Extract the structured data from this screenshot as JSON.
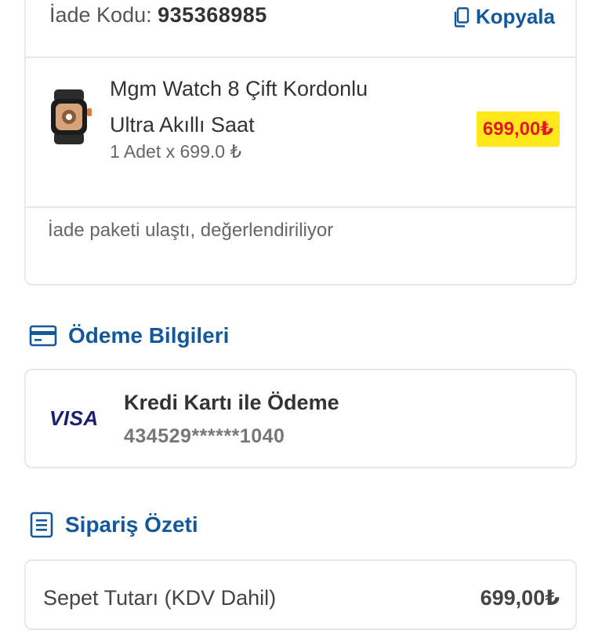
{
  "return": {
    "code_label": "İade Kodu:",
    "code_value": "935368985",
    "copy_label": "Kopyala",
    "status": "İade paketi ulaştı, değerlendiriliyor"
  },
  "product": {
    "title_line1": "Mgm Watch 8 Çift Kordonlu",
    "title_line2": "Ultra Akıllı Saat",
    "quantity": "1 Adet x 699.0 ₺",
    "price": "699,00₺",
    "image_icon": "smartwatch-image"
  },
  "payment": {
    "section_title": "Ödeme Bilgileri",
    "section_icon": "credit-card-icon",
    "brand": "VISA",
    "method": "Kredi Kartı ile Ödeme",
    "card_number": "434529******1040"
  },
  "summary": {
    "section_title": "Sipariş Özeti",
    "section_icon": "receipt-icon",
    "cart_total_label": "Sepet Tutarı (KDV Dahil)",
    "cart_total_value": "699,00₺"
  },
  "colors": {
    "accent": "#14589c",
    "price_bg": "#ffe81a",
    "price_text": "#e21b23",
    "border": "#e6e8ec"
  }
}
